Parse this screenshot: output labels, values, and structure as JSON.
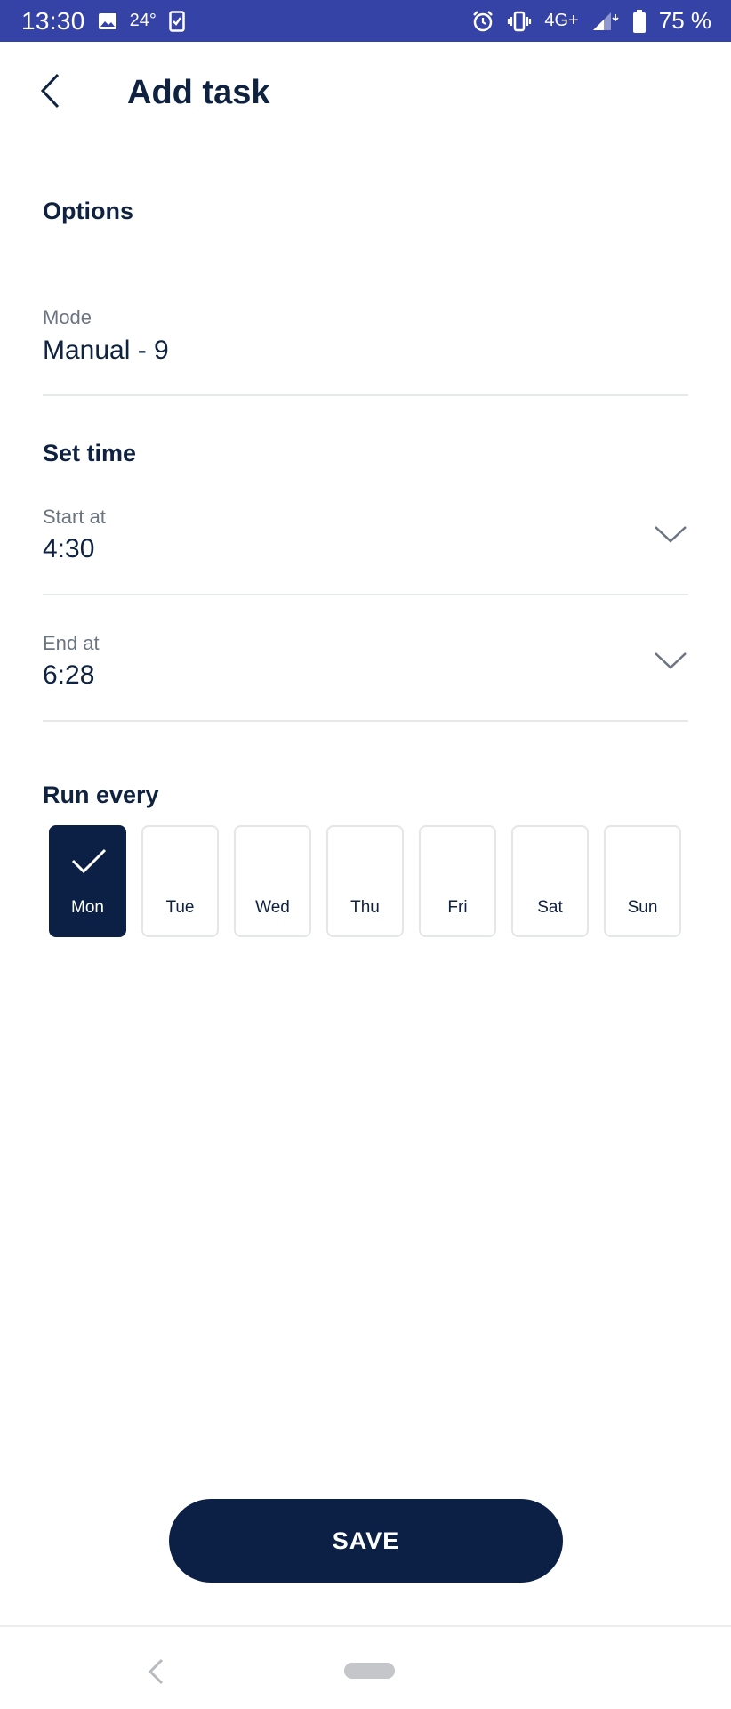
{
  "status_bar": {
    "time": "13:30",
    "temperature": "24°",
    "network": "4G+",
    "battery": "75 %",
    "icons": [
      "image-icon",
      "checklist-icon",
      "alarm-icon",
      "vibrate-icon",
      "signal-icon",
      "battery-icon"
    ]
  },
  "header": {
    "title": "Add task",
    "back_icon": "chevron-left-icon"
  },
  "options": {
    "heading": "Options",
    "mode_label": "Mode",
    "mode_value": "Manual - 9"
  },
  "set_time": {
    "heading": "Set time",
    "start_label": "Start at",
    "start_value": "4:30",
    "end_label": "End at",
    "end_value": "6:28"
  },
  "run_every": {
    "heading": "Run every",
    "days": [
      {
        "label": "Mon",
        "selected": true
      },
      {
        "label": "Tue",
        "selected": false
      },
      {
        "label": "Wed",
        "selected": false
      },
      {
        "label": "Thu",
        "selected": false
      },
      {
        "label": "Fri",
        "selected": false
      },
      {
        "label": "Sat",
        "selected": false
      },
      {
        "label": "Sun",
        "selected": false
      }
    ]
  },
  "actions": {
    "save_label": "SAVE"
  },
  "colors": {
    "status_bar": "#3542a6",
    "primary": "#0b2044",
    "text_muted": "#6b7480",
    "divider": "#e6e8ec"
  }
}
